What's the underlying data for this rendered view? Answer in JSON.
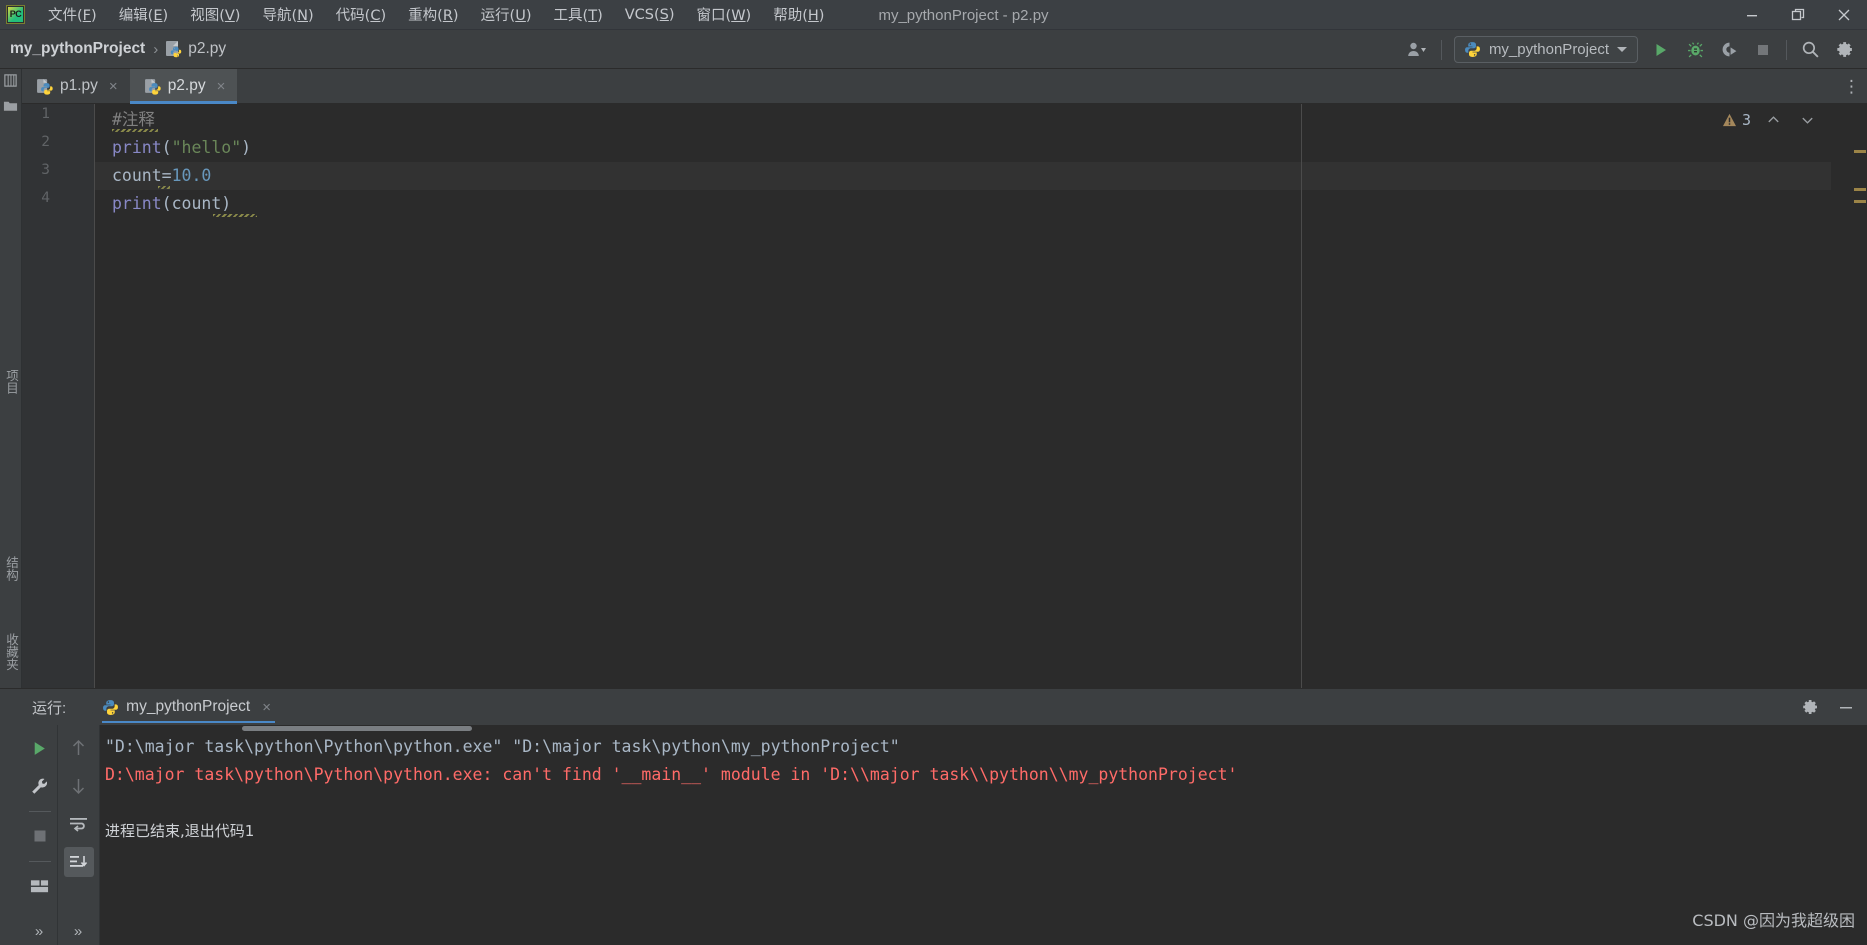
{
  "window": {
    "title": "my_pythonProject - p2.py",
    "app_icon": "pycharm-logo-icon",
    "controls": [
      {
        "name": "minimize-button",
        "glyph": "minimize-icon"
      },
      {
        "name": "restore-button",
        "glyph": "restore-icon"
      },
      {
        "name": "close-button",
        "glyph": "close-icon"
      }
    ]
  },
  "menubar": {
    "items": [
      {
        "label": "文件(F)",
        "mnemonic": "F"
      },
      {
        "label": "编辑(E)",
        "mnemonic": "E"
      },
      {
        "label": "视图(V)",
        "mnemonic": "V"
      },
      {
        "label": "导航(N)",
        "mnemonic": "N"
      },
      {
        "label": "代码(C)",
        "mnemonic": "C"
      },
      {
        "label": "重构(R)",
        "mnemonic": "R"
      },
      {
        "label": "运行(U)",
        "mnemonic": "U"
      },
      {
        "label": "工具(T)",
        "mnemonic": "T"
      },
      {
        "label": "VCS(S)",
        "mnemonic": "S"
      },
      {
        "label": "窗口(W)",
        "mnemonic": "W"
      },
      {
        "label": "帮助(H)",
        "mnemonic": "H"
      }
    ]
  },
  "navbar": {
    "breadcrumb": {
      "project": "my_pythonProject",
      "separator": "›",
      "file": "p2.py",
      "file_icon": "python-file-icon"
    },
    "account_icon": "user-account-icon",
    "run_config": {
      "label": "my_pythonProject",
      "icon": "python-icon",
      "caret": "chevron-down-icon"
    },
    "actions": [
      {
        "name": "run-button",
        "icon": "run-triangle-icon",
        "color": "#59a869"
      },
      {
        "name": "debug-button",
        "icon": "debug-bug-icon",
        "color": "#59a869"
      },
      {
        "name": "run-with-coverage-button",
        "icon": "coverage-icon",
        "color": "#9aa0a6"
      },
      {
        "name": "stop-button",
        "icon": "stop-square-icon",
        "color": "#8a8e92"
      },
      {
        "name": "search-everywhere-button",
        "icon": "search-icon",
        "color": "#b0b4b8"
      },
      {
        "name": "settings-button",
        "icon": "gear-icon",
        "color": "#b0b4b8"
      }
    ]
  },
  "left_strip": {
    "items": [
      {
        "label": "项目",
        "name": "tool-window-project"
      },
      {
        "label": "结构",
        "name": "tool-window-structure"
      },
      {
        "label": "收藏夹",
        "name": "tool-window-favorites"
      }
    ]
  },
  "editor": {
    "tabs": [
      {
        "label": "p1.py",
        "icon": "python-file-icon",
        "active": false,
        "close": "×"
      },
      {
        "label": "p2.py",
        "icon": "python-file-icon",
        "active": true,
        "close": "×"
      }
    ],
    "more_tabs": "⋮",
    "warning_badge": {
      "icon": "warning-triangle-icon",
      "count": "3",
      "prev": "chevron-up-icon",
      "next": "chevron-down-icon"
    },
    "lines": [
      {
        "num": "1",
        "cursor": false,
        "tokens": [
          {
            "t": "#注释",
            "c": "c-comment"
          }
        ],
        "squiggle": true
      },
      {
        "num": "2",
        "cursor": false,
        "tokens": [
          {
            "t": "print",
            "c": "c-fn"
          },
          {
            "t": "(",
            "c": "c-paren"
          },
          {
            "t": "\"hello\"",
            "c": "c-str"
          },
          {
            "t": ")",
            "c": "c-paren"
          }
        ]
      },
      {
        "num": "3",
        "cursor": true,
        "tokens": [
          {
            "t": "count",
            "c": "c-id"
          },
          {
            "t": "=",
            "c": "c-paren"
          },
          {
            "t": "10.0",
            "c": "c-num"
          }
        ]
      },
      {
        "num": "4",
        "cursor": false,
        "tokens": [
          {
            "t": "print",
            "c": "c-fn"
          },
          {
            "t": "(",
            "c": "c-paren"
          },
          {
            "t": "count",
            "c": "c-id"
          },
          {
            "t": ")",
            "c": "c-paren"
          }
        ]
      }
    ]
  },
  "run_window": {
    "title": "运行:",
    "tab": {
      "label": "my_pythonProject",
      "icon": "python-icon",
      "close": "×"
    },
    "header_actions": [
      {
        "name": "run-settings-button",
        "icon": "gear-icon"
      },
      {
        "name": "hide-button",
        "icon": "minimize-icon"
      }
    ],
    "sidebar": [
      {
        "name": "rerun-button",
        "icon": "run-triangle-icon",
        "color": "#59a869"
      },
      {
        "name": "edit-configurations-button",
        "icon": "wrench-icon",
        "color": "#c2c5c9"
      },
      {
        "name": "stop-button",
        "icon": "stop-square-icon",
        "color": "#6e7175"
      },
      {
        "name": "layout-button",
        "icon": "layout-icon",
        "color": "#b5b9bd"
      },
      {
        "name": "expand-sidebar-button",
        "icon": "chevrons-right-icon",
        "color": "#b0b4b8"
      }
    ],
    "sidebar2": [
      {
        "name": "up-stack-button",
        "icon": "arrow-up-icon",
        "color": "#6e7175"
      },
      {
        "name": "down-stack-button",
        "icon": "arrow-down-icon",
        "color": "#6e7175"
      },
      {
        "name": "soft-wrap-button",
        "icon": "soft-wrap-icon",
        "color": "#b5b9bd"
      },
      {
        "name": "scroll-to-end-button",
        "icon": "scroll-end-icon",
        "color": "#c8cbcf",
        "selected": true
      },
      {
        "name": "expand-sidebar2-button",
        "icon": "chevrons-right-icon",
        "color": "#b0b4b8"
      }
    ],
    "console": [
      {
        "text": "\"D:\\major task\\python\\Python\\python.exe\" \"D:\\major task\\python\\my_pythonProject\"",
        "type": "out"
      },
      {
        "text": "D:\\major task\\python\\Python\\python.exe: can't find '__main__' module in 'D:\\\\major task\\\\python\\\\my_pythonProject'",
        "type": "err"
      },
      {
        "text": "",
        "type": "out"
      },
      {
        "text": "进程已结束,退出代码1",
        "type": "cn"
      }
    ]
  },
  "watermark": "CSDN @因为我超级困",
  "colors": {
    "accent_blue": "#4a88c7",
    "run_green": "#59a869",
    "error_red": "#ff6b68",
    "string_green": "#6a8759",
    "number_blue": "#6897bb",
    "keyword_purple": "#8888c6",
    "editor_bg": "#2b2b2b",
    "chrome_bg": "#3c3f41"
  }
}
